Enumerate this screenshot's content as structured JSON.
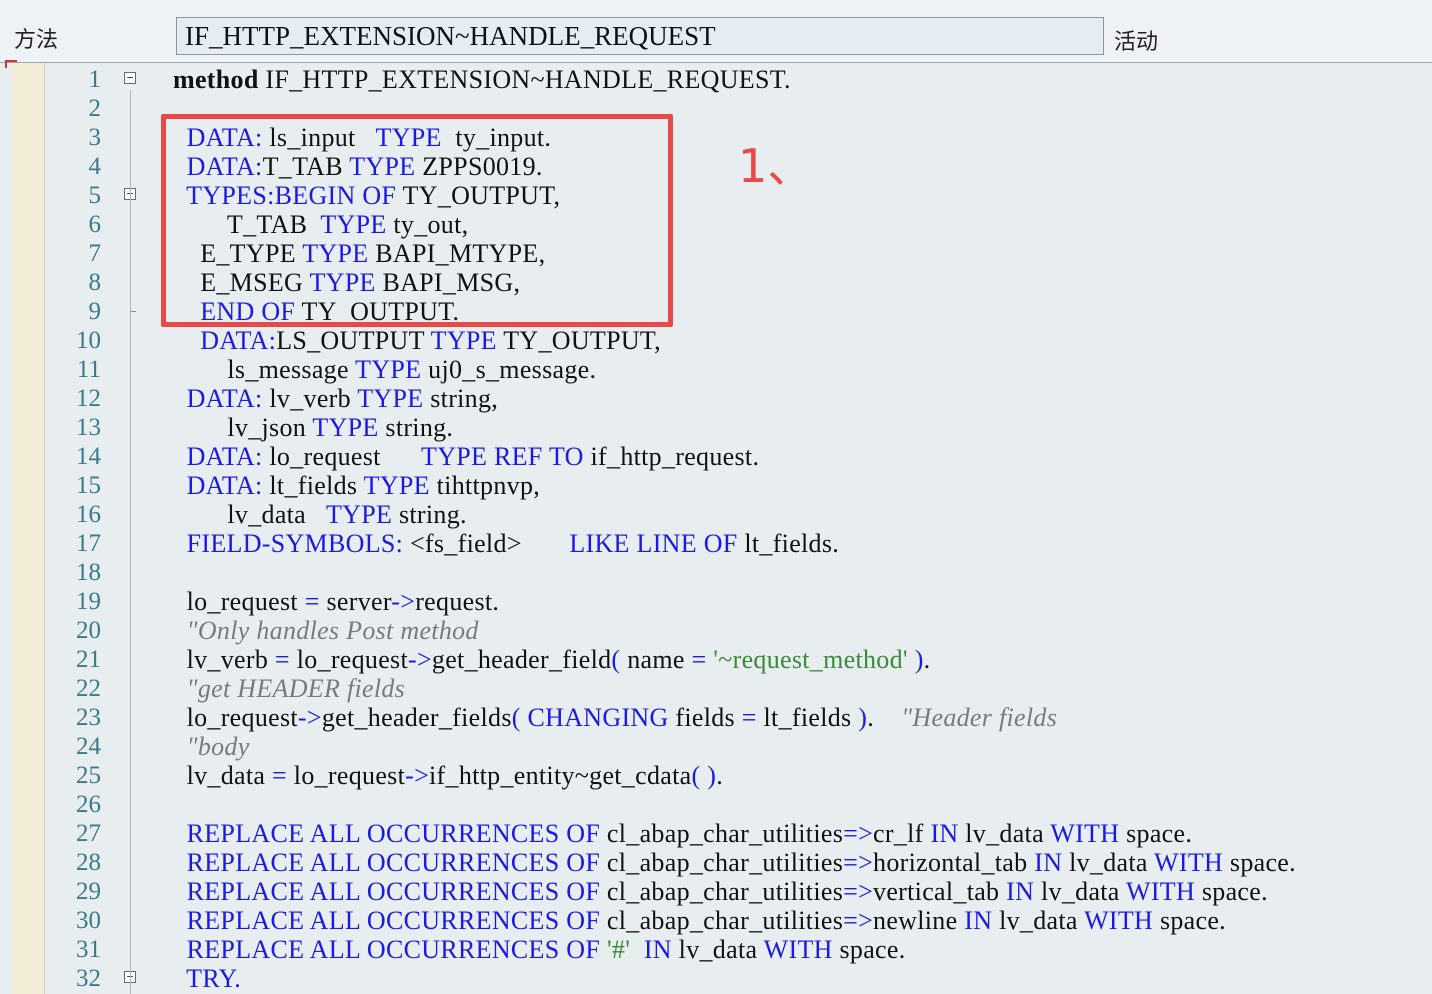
{
  "header": {
    "label": "方法",
    "method_name": "IF_HTTP_EXTENSION~HANDLE_REQUEST",
    "status": "活动"
  },
  "annotation": {
    "text": "1、",
    "color": "#e84a4a"
  },
  "colors": {
    "keyword": "#1a1ae0",
    "comment": "#7a7a7a",
    "string": "#3a8a3a",
    "line_number": "#3a7a8a",
    "highlight": "#e84a4a",
    "background": "#e8eef0"
  },
  "lines": [
    {
      "n": "1",
      "fold": "minus",
      "tokens": [
        [
          "bold",
          "method"
        ],
        [
          "t",
          " IF_HTTP_EXTENSION~HANDLE_REQUEST."
        ]
      ]
    },
    {
      "n": "2",
      "tokens": []
    },
    {
      "n": "3",
      "tokens": [
        [
          "t",
          "  "
        ],
        [
          "kw",
          "DATA:"
        ],
        [
          "t",
          " ls_input   "
        ],
        [
          "kw",
          "TYPE"
        ],
        [
          "t",
          "  ty_input."
        ]
      ]
    },
    {
      "n": "4",
      "tokens": [
        [
          "t",
          "  "
        ],
        [
          "kw",
          "DATA:"
        ],
        [
          "t",
          "T_TAB "
        ],
        [
          "kw",
          "TYPE"
        ],
        [
          "t",
          " ZPPS0019."
        ]
      ]
    },
    {
      "n": "5",
      "fold": "minus",
      "tokens": [
        [
          "t",
          "  "
        ],
        [
          "kw",
          "TYPES:BEGIN OF"
        ],
        [
          "t",
          " TY_OUTPUT,"
        ]
      ]
    },
    {
      "n": "6",
      "tokens": [
        [
          "t",
          "        T_TAB  "
        ],
        [
          "kw",
          "TYPE"
        ],
        [
          "t",
          " ty_out,"
        ]
      ]
    },
    {
      "n": "7",
      "tokens": [
        [
          "t",
          "    E_TYPE "
        ],
        [
          "kw",
          "TYPE"
        ],
        [
          "t",
          " BAPI_MTYPE,"
        ]
      ]
    },
    {
      "n": "8",
      "tokens": [
        [
          "t",
          "    E_MSEG "
        ],
        [
          "kw",
          "TYPE"
        ],
        [
          "t",
          " BAPI_MSG,"
        ]
      ]
    },
    {
      "n": "9",
      "fold": "tick",
      "tokens": [
        [
          "t",
          "    "
        ],
        [
          "kw",
          "END OF"
        ],
        [
          "t",
          " TY_OUTPUT."
        ]
      ]
    },
    {
      "n": "10",
      "tokens": [
        [
          "t",
          "    "
        ],
        [
          "kw",
          "DATA:"
        ],
        [
          "t",
          "LS_OUTPUT "
        ],
        [
          "kw",
          "TYPE"
        ],
        [
          "t",
          " TY_OUTPUT,"
        ]
      ]
    },
    {
      "n": "11",
      "tokens": [
        [
          "t",
          "        ls_message "
        ],
        [
          "kw",
          "TYPE"
        ],
        [
          "t",
          " uj0_s_message."
        ]
      ]
    },
    {
      "n": "12",
      "tokens": [
        [
          "t",
          "  "
        ],
        [
          "kw",
          "DATA:"
        ],
        [
          "t",
          " lv_verb "
        ],
        [
          "kw",
          "TYPE"
        ],
        [
          "t",
          " string,"
        ]
      ]
    },
    {
      "n": "13",
      "tokens": [
        [
          "t",
          "        lv_json "
        ],
        [
          "kw",
          "TYPE"
        ],
        [
          "t",
          " string."
        ]
      ]
    },
    {
      "n": "14",
      "tokens": [
        [
          "t",
          "  "
        ],
        [
          "kw",
          "DATA:"
        ],
        [
          "t",
          " lo_request      "
        ],
        [
          "kw",
          "TYPE REF TO"
        ],
        [
          "t",
          " if_http_request."
        ]
      ]
    },
    {
      "n": "15",
      "tokens": [
        [
          "t",
          "  "
        ],
        [
          "kw",
          "DATA:"
        ],
        [
          "t",
          " lt_fields "
        ],
        [
          "kw",
          "TYPE"
        ],
        [
          "t",
          " tihttpnvp,"
        ]
      ]
    },
    {
      "n": "16",
      "tokens": [
        [
          "t",
          "        lv_data   "
        ],
        [
          "kw",
          "TYPE"
        ],
        [
          "t",
          " string."
        ]
      ]
    },
    {
      "n": "17",
      "tokens": [
        [
          "t",
          "  "
        ],
        [
          "kw",
          "FIELD-SYMBOLS:"
        ],
        [
          "t",
          " <fs_field>       "
        ],
        [
          "kw",
          "LIKE LINE OF"
        ],
        [
          "t",
          " lt_fields."
        ]
      ]
    },
    {
      "n": "18",
      "tokens": []
    },
    {
      "n": "19",
      "tokens": [
        [
          "t",
          "  lo_request "
        ],
        [
          "op",
          "="
        ],
        [
          "t",
          " server"
        ],
        [
          "op",
          "->"
        ],
        [
          "t",
          "request."
        ]
      ]
    },
    {
      "n": "20",
      "tokens": [
        [
          "t",
          "  "
        ],
        [
          "cm",
          "\"Only handles Post method"
        ]
      ]
    },
    {
      "n": "21",
      "tokens": [
        [
          "t",
          "  lv_verb "
        ],
        [
          "op",
          "="
        ],
        [
          "t",
          " lo_request"
        ],
        [
          "op",
          "->"
        ],
        [
          "t",
          "get_header_field"
        ],
        [
          "op",
          "("
        ],
        [
          "t",
          " name "
        ],
        [
          "op",
          "="
        ],
        [
          "t",
          " "
        ],
        [
          "str",
          "'~request_method'"
        ],
        [
          "t",
          " "
        ],
        [
          "op",
          ")"
        ],
        [
          "t",
          "."
        ]
      ]
    },
    {
      "n": "22",
      "tokens": [
        [
          "t",
          "  "
        ],
        [
          "cm",
          "\"get HEADER fields"
        ]
      ]
    },
    {
      "n": "23",
      "tokens": [
        [
          "t",
          "  lo_request"
        ],
        [
          "op",
          "->"
        ],
        [
          "t",
          "get_header_fields"
        ],
        [
          "op",
          "("
        ],
        [
          "t",
          " "
        ],
        [
          "kw",
          "CHANGING"
        ],
        [
          "t",
          " fields "
        ],
        [
          "op",
          "="
        ],
        [
          "t",
          " lt_fields "
        ],
        [
          "op",
          ")"
        ],
        [
          "t",
          ".    "
        ],
        [
          "cm",
          "\"Header fields"
        ]
      ]
    },
    {
      "n": "24",
      "tokens": [
        [
          "t",
          "  "
        ],
        [
          "cm",
          "\"body"
        ]
      ]
    },
    {
      "n": "25",
      "tokens": [
        [
          "t",
          "  lv_data "
        ],
        [
          "op",
          "="
        ],
        [
          "t",
          " lo_request"
        ],
        [
          "op",
          "->"
        ],
        [
          "t",
          "if_http_entity~get_cdata"
        ],
        [
          "op",
          "("
        ],
        [
          "t",
          " "
        ],
        [
          "op",
          ")"
        ],
        [
          "t",
          "."
        ]
      ]
    },
    {
      "n": "26",
      "tokens": []
    },
    {
      "n": "27",
      "tokens": [
        [
          "t",
          "  "
        ],
        [
          "kw",
          "REPLACE ALL OCCURRENCES OF"
        ],
        [
          "t",
          " cl_abap_char_utilities"
        ],
        [
          "op",
          "=>"
        ],
        [
          "t",
          "cr_lf "
        ],
        [
          "kw",
          "IN"
        ],
        [
          "t",
          " lv_data "
        ],
        [
          "kw",
          "WITH"
        ],
        [
          "t",
          " space."
        ]
      ]
    },
    {
      "n": "28",
      "tokens": [
        [
          "t",
          "  "
        ],
        [
          "kw",
          "REPLACE ALL OCCURRENCES OF"
        ],
        [
          "t",
          " cl_abap_char_utilities"
        ],
        [
          "op",
          "=>"
        ],
        [
          "t",
          "horizontal_tab "
        ],
        [
          "kw",
          "IN"
        ],
        [
          "t",
          " lv_data "
        ],
        [
          "kw",
          "WITH"
        ],
        [
          "t",
          " space."
        ]
      ]
    },
    {
      "n": "29",
      "tokens": [
        [
          "t",
          "  "
        ],
        [
          "kw",
          "REPLACE ALL OCCURRENCES OF"
        ],
        [
          "t",
          " cl_abap_char_utilities"
        ],
        [
          "op",
          "=>"
        ],
        [
          "t",
          "vertical_tab "
        ],
        [
          "kw",
          "IN"
        ],
        [
          "t",
          " lv_data "
        ],
        [
          "kw",
          "WITH"
        ],
        [
          "t",
          " space."
        ]
      ]
    },
    {
      "n": "30",
      "tokens": [
        [
          "t",
          "  "
        ],
        [
          "kw",
          "REPLACE ALL OCCURRENCES OF"
        ],
        [
          "t",
          " cl_abap_char_utilities"
        ],
        [
          "op",
          "=>"
        ],
        [
          "t",
          "newline "
        ],
        [
          "kw",
          "IN"
        ],
        [
          "t",
          " lv_data "
        ],
        [
          "kw",
          "WITH"
        ],
        [
          "t",
          " space."
        ]
      ]
    },
    {
      "n": "31",
      "tokens": [
        [
          "t",
          "  "
        ],
        [
          "kw",
          "REPLACE ALL OCCURRENCES OF"
        ],
        [
          "t",
          " "
        ],
        [
          "str",
          "'#'"
        ],
        [
          "t",
          "  "
        ],
        [
          "kw",
          "IN"
        ],
        [
          "t",
          " lv_data "
        ],
        [
          "kw",
          "WITH"
        ],
        [
          "t",
          " space."
        ]
      ]
    },
    {
      "n": "32",
      "fold": "minus",
      "tokens": [
        [
          "t",
          "  "
        ],
        [
          "kw",
          "TRY."
        ]
      ]
    }
  ]
}
